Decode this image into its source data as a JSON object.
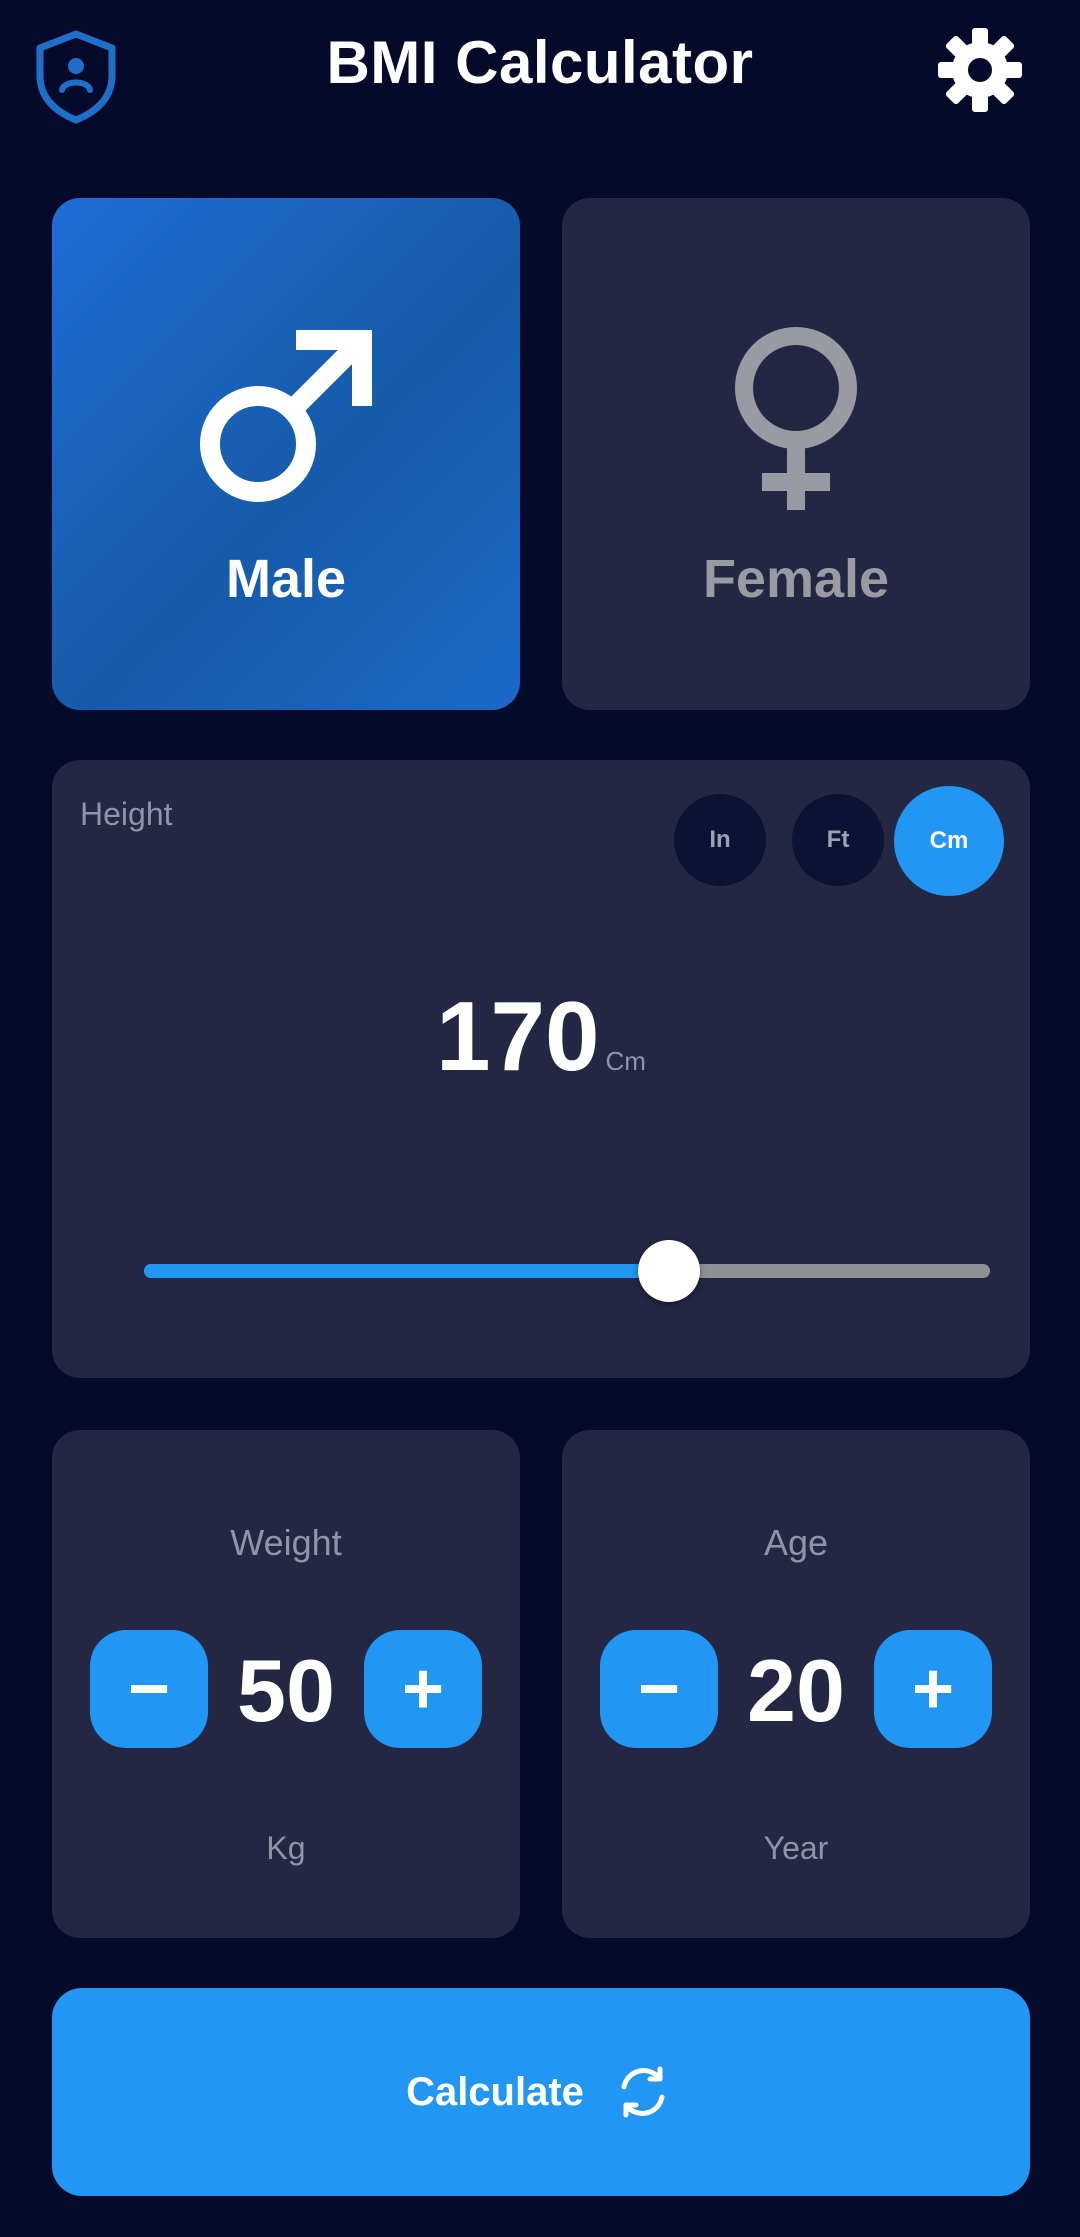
{
  "header": {
    "title": "BMI Calculator",
    "left_icon": "shield-icon",
    "right_icon": "gear-icon"
  },
  "gender": {
    "options": [
      {
        "label": "Male",
        "icon": "male-icon",
        "selected": true
      },
      {
        "label": "Female",
        "icon": "female-icon",
        "selected": false
      }
    ]
  },
  "height": {
    "label": "Height",
    "units": [
      "In",
      "Ft",
      "Cm"
    ],
    "selected_unit": "Cm",
    "value": "170",
    "value_unit": "Cm",
    "slider_fraction": 0.62
  },
  "weight": {
    "title": "Weight",
    "value": "50",
    "unit": "Kg",
    "minus": "−",
    "plus": "+"
  },
  "age": {
    "title": "Age",
    "value": "20",
    "unit": "Year",
    "minus": "−",
    "plus": "+"
  },
  "calculate": {
    "label": "Calculate",
    "icon": "refresh-icon"
  },
  "colors": {
    "background": "#050a2b",
    "card": "#232743",
    "accent": "#2196f3",
    "selected_card": "#1b69c9"
  }
}
